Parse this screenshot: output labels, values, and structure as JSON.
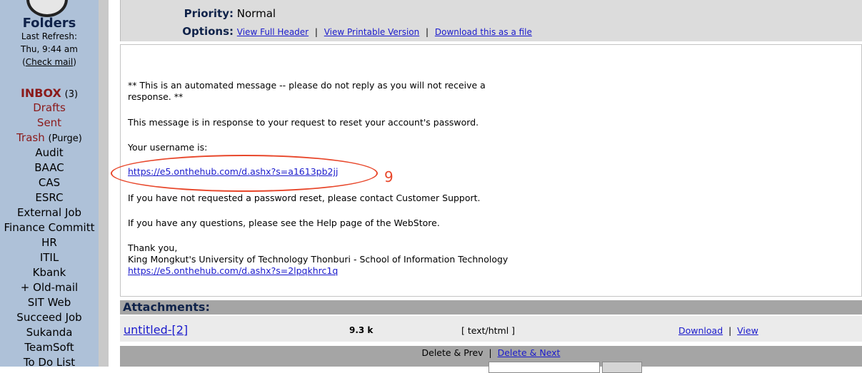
{
  "sidebar": {
    "title": "Folders",
    "last_refresh_label": "Last Refresh:",
    "last_refresh_time": "Thu, 9:44 am",
    "check_mail_open": "(",
    "check_mail": "Check mail",
    "check_mail_close": ")",
    "inbox": "INBOX",
    "inbox_count": "(3)",
    "drafts": "Drafts",
    "sent": "Sent",
    "trash": "Trash",
    "purge": "(Purge)",
    "folders": [
      "Audit",
      "BAAC",
      "CAS",
      "ESRC",
      "External Job",
      "Finance Committ",
      "HR",
      "ITIL",
      "Kbank",
      "+ Old-mail",
      "SIT Web",
      "Succeed Job",
      "Sukanda",
      "TeamSoft",
      "To Do List"
    ]
  },
  "header": {
    "priority_label": "Priority:",
    "priority_value": "Normal",
    "options_label": "Options:",
    "view_full_header": "View Full Header",
    "view_printable": "View Printable Version",
    "download_file": "Download this as a file",
    "sep": "|"
  },
  "message": {
    "line1": "** This is an automated message -- please do not reply as you will not receive a",
    "line2": "response. **",
    "line3": "This message is in response to your request to reset your account's password.",
    "line4": "Your username is:",
    "username_link": "https://e5.onthehub.com/d.ashx?s=a1613pb2jj",
    "line5": "If you have not requested a password reset, please contact Customer Support.",
    "line6": "If you have any questions, please see the Help page of the WebStore.",
    "line7": "Thank you,",
    "line8": "King Mongkut's University of Technology Thonburi - School of Information Technology",
    "footer_link": "https://e5.onthehub.com/d.ashx?s=2lpqkhrc1q",
    "annotation": "9",
    "annotation_color": "#e8472b"
  },
  "attachments": {
    "heading": "Attachments:",
    "name": "untitled-[2]",
    "size": "9.3 k",
    "type": "[ text/html ]",
    "download": "Download",
    "view": "View",
    "sep": "|"
  },
  "bottom": {
    "delete_prev": "Delete & Prev",
    "sep": "|",
    "delete_next": "Delete & Next"
  }
}
